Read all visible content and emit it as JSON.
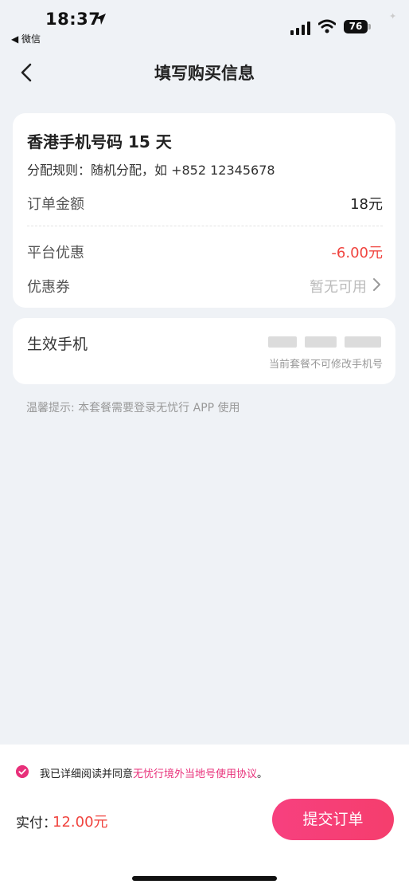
{
  "status": {
    "time": "18:37",
    "back_app": "◀ 微信",
    "battery": "76"
  },
  "nav": {
    "title": "填写购买信息"
  },
  "product": {
    "name": "香港手机号码 15 天",
    "rule": "分配规则：随机分配，如 +852 12345678",
    "order_amount_label": "订单金额",
    "order_amount_value": "18元",
    "discount_label": "平台优惠",
    "discount_value": "-6.00元",
    "coupon_label": "优惠券",
    "coupon_value": "暂无可用"
  },
  "phone": {
    "label": "生效手机",
    "note": "当前套餐不可修改手机号"
  },
  "tip": "温馨提示: 本套餐需要登录无忧行 APP 使用",
  "bottom": {
    "agree_prefix": "我已详细阅读并同意",
    "agree_link": "无忧行境外当地号使用协议",
    "agree_suffix": "。",
    "pay_label": "实付：",
    "pay_amount": "12.00元",
    "submit_label": "提交订单"
  },
  "colors": {
    "accent": "#e8307a",
    "price": "#f0443f",
    "background": "#eff2f6"
  }
}
